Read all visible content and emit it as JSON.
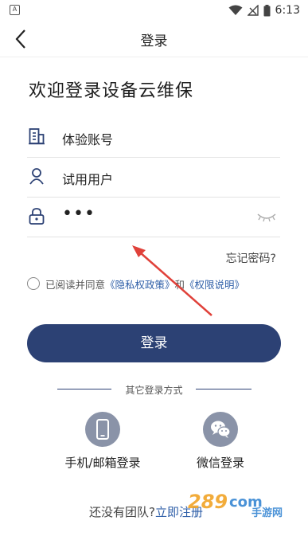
{
  "status_bar": {
    "left_icon": "A",
    "time": "6:13"
  },
  "nav": {
    "title": "登录"
  },
  "welcome": "欢迎登录设备云维保",
  "form": {
    "account": "体验账号",
    "username": "试用用户",
    "password_mask": "•••"
  },
  "forgot_password": "忘记密码?",
  "agreement": {
    "prefix": "已阅读并同意",
    "privacy": "《隐私权政策》",
    "and": "和",
    "permission": "《权限说明》"
  },
  "login_button": "登录",
  "other_login": {
    "label": "其它登录方式",
    "phone_email": "手机/邮箱登录",
    "wechat": "微信登录"
  },
  "footer": {
    "prefix": "还没有团队?",
    "link": "立即注册"
  },
  "watermark": {
    "brand": "289",
    "domain": "com",
    "tagline": "手游网"
  },
  "colors": {
    "primary": "#2c4174",
    "link": "#2f5fa8",
    "icon_circle": "#8a93a8",
    "annotation_arrow": "#e0413a"
  }
}
